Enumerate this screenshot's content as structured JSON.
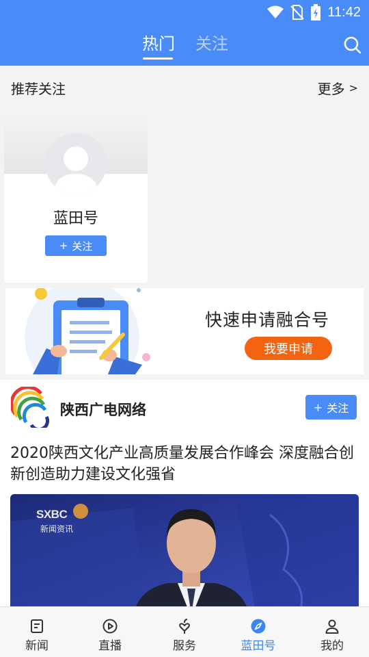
{
  "status_bar": {
    "time": "11:42"
  },
  "header": {
    "tabs": [
      {
        "label": "热门",
        "active": true
      },
      {
        "label": "关注",
        "active": false
      }
    ],
    "accent_color": "#4a8cf7"
  },
  "recommend": {
    "title": "推荐关注",
    "more_label": "更多",
    "more_chevron": ">",
    "card": {
      "name": "蓝田号",
      "follow_label": "关注",
      "follow_plus": "+"
    }
  },
  "banner": {
    "title": "快速申请融合号",
    "button_label": "我要申请",
    "button_color": "#f26411"
  },
  "feed": {
    "source_name": "陕西广电网络",
    "follow_label": "关注",
    "follow_plus": "+",
    "article_title": "2020陕西文化产业高质量发展合作峰会 深度融合创新创造助力建设文化强省",
    "image_caption_logo": "SXBC",
    "image_caption_text": "新闻资讯"
  },
  "bottom_nav": [
    {
      "label": "新闻",
      "icon": "news-icon",
      "active": false
    },
    {
      "label": "直播",
      "icon": "play-icon",
      "active": false
    },
    {
      "label": "服务",
      "icon": "service-icon",
      "active": false
    },
    {
      "label": "蓝田号",
      "icon": "compass-icon",
      "active": true
    },
    {
      "label": "我的",
      "icon": "user-icon",
      "active": false
    }
  ]
}
